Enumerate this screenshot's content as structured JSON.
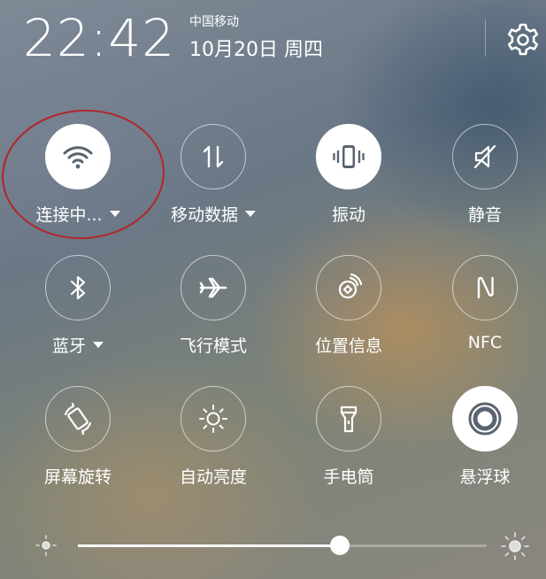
{
  "status": {
    "time": "22:42",
    "carrier": "中国移动",
    "date": "10月20日 周四"
  },
  "toggles": [
    {
      "label": "连接中...",
      "icon": "wifi-icon",
      "active": true,
      "dropdown": true
    },
    {
      "label": "移动数据",
      "icon": "mobile-data-icon",
      "active": false,
      "dropdown": true
    },
    {
      "label": "振动",
      "icon": "vibrate-icon",
      "active": true,
      "dropdown": false
    },
    {
      "label": "静音",
      "icon": "mute-icon",
      "active": false,
      "dropdown": false
    },
    {
      "label": "蓝牙",
      "icon": "bluetooth-icon",
      "active": false,
      "dropdown": true
    },
    {
      "label": "飞行模式",
      "icon": "airplane-icon",
      "active": false,
      "dropdown": false
    },
    {
      "label": "位置信息",
      "icon": "location-icon",
      "active": false,
      "dropdown": false
    },
    {
      "label": "NFC",
      "icon": "nfc-icon",
      "active": false,
      "dropdown": false
    },
    {
      "label": "屏幕旋转",
      "icon": "rotate-screen-icon",
      "active": false,
      "dropdown": false
    },
    {
      "label": "自动亮度",
      "icon": "auto-brightness-icon",
      "active": false,
      "dropdown": false
    },
    {
      "label": "手电筒",
      "icon": "flashlight-icon",
      "active": false,
      "dropdown": false
    },
    {
      "label": "悬浮球",
      "icon": "floating-ball-icon",
      "active": true,
      "dropdown": false
    }
  ],
  "brightness": {
    "level": 0.64
  },
  "colors": {
    "active_icon": "#5a6470",
    "highlight_ring": "#b1262a"
  }
}
